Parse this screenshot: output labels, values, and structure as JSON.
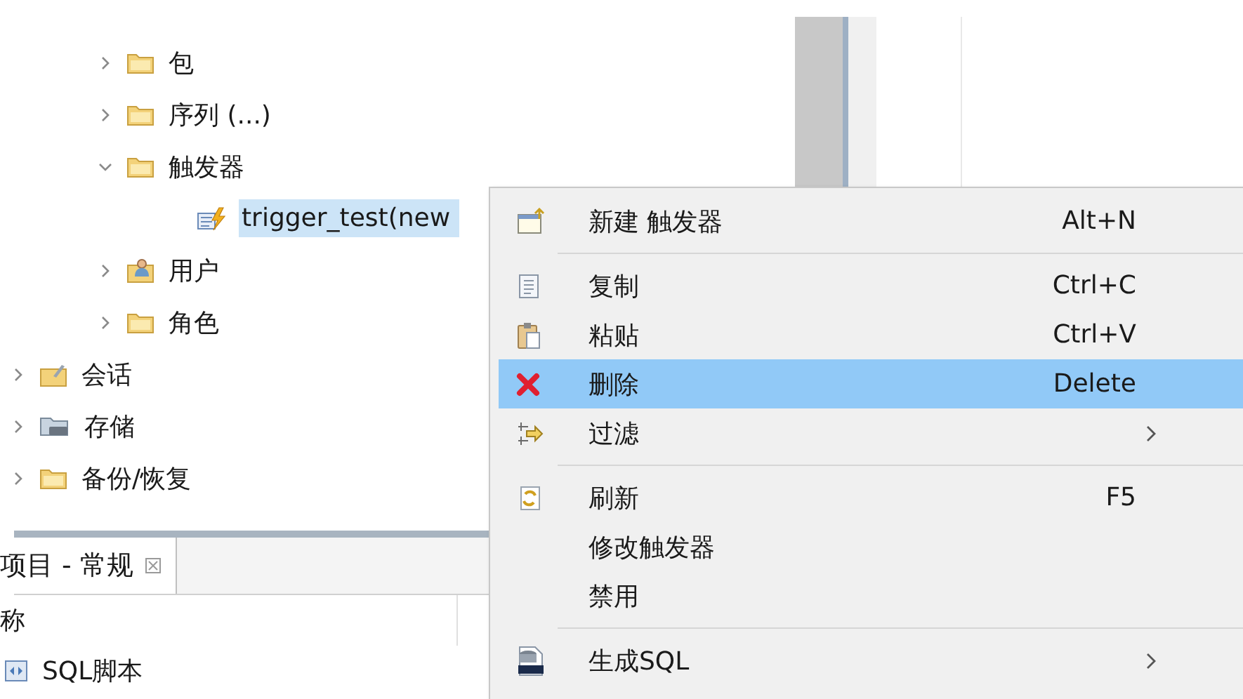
{
  "tree": {
    "nested_items": [
      {
        "label": "包",
        "kind": "folder",
        "expanded": false,
        "selected": false
      },
      {
        "label": "序列 (...)",
        "kind": "folder",
        "expanded": false,
        "selected": false
      },
      {
        "label": "触发器",
        "kind": "folder",
        "expanded": true,
        "selected": false,
        "children": [
          {
            "label": "trigger_test(new",
            "kind": "trigger",
            "selected": true
          }
        ]
      },
      {
        "label": "用户",
        "kind": "user",
        "expanded": false,
        "selected": false
      },
      {
        "label": "角色",
        "kind": "folder",
        "expanded": false,
        "selected": false
      }
    ],
    "items": [
      {
        "label": "会话",
        "kind": "session",
        "expanded": false,
        "selected": false
      },
      {
        "label": "存储",
        "kind": "storage",
        "expanded": false,
        "selected": false
      },
      {
        "label": "备份/恢复",
        "kind": "folder",
        "expanded": false,
        "selected": false
      }
    ]
  },
  "bottom_panel": {
    "tab": {
      "label": "项目 - 常规",
      "closable": true
    },
    "column_1": "称",
    "rows": [
      {
        "label": "SQL脚本",
        "kind": "script"
      }
    ]
  },
  "context_menu": [
    {
      "kind": "new",
      "label": "新建 触发器",
      "shortcut": "Alt+N",
      "submenu": false,
      "selected": false
    },
    {
      "kind": "separator"
    },
    {
      "kind": "copy",
      "label": "复制",
      "shortcut": "Ctrl+C",
      "submenu": false,
      "selected": false
    },
    {
      "kind": "paste",
      "label": "粘贴",
      "shortcut": "Ctrl+V",
      "submenu": false,
      "selected": false
    },
    {
      "kind": "delete",
      "label": "删除",
      "shortcut": "Delete",
      "submenu": false,
      "selected": true
    },
    {
      "kind": "filter",
      "label": "过滤",
      "submenu": true,
      "selected": false
    },
    {
      "kind": "separator"
    },
    {
      "kind": "refresh",
      "label": "刷新",
      "shortcut": "F5",
      "submenu": false,
      "selected": false
    },
    {
      "kind": "plain",
      "label": "修改触发器",
      "submenu": false,
      "selected": false
    },
    {
      "kind": "plain",
      "label": "禁用",
      "submenu": false,
      "selected": false
    },
    {
      "kind": "separator"
    },
    {
      "kind": "sql",
      "label": "生成SQL",
      "submenu": true,
      "selected": false
    }
  ]
}
